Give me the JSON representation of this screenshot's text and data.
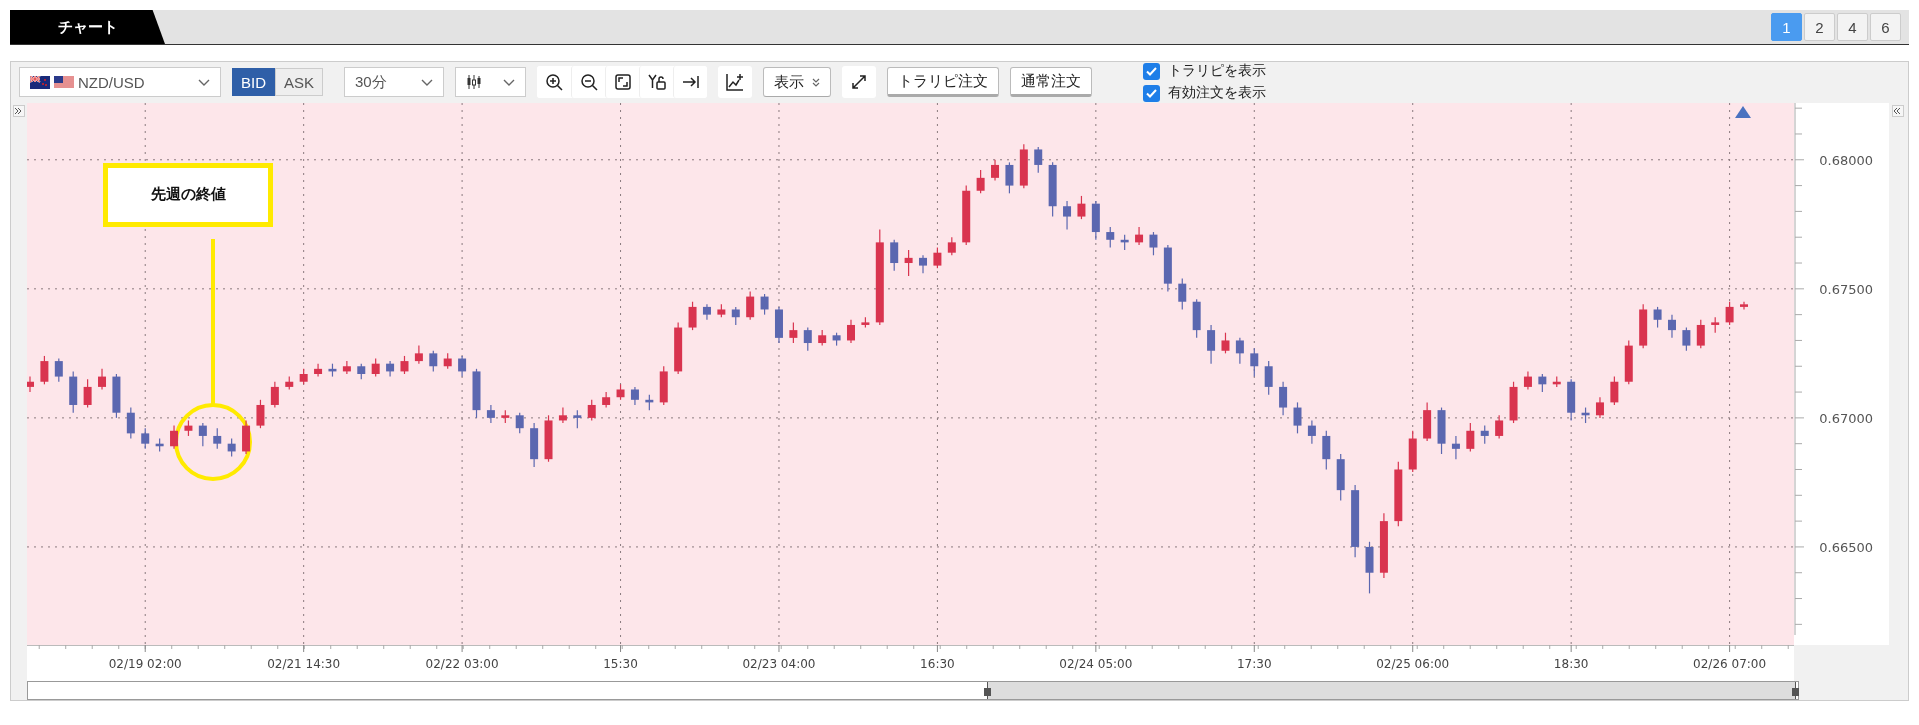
{
  "header": {
    "tab": {
      "label": "チャート",
      "selected": true
    },
    "layouts": [
      {
        "label": "1",
        "selected": true
      },
      {
        "label": "2",
        "selected": false
      },
      {
        "label": "4",
        "selected": false
      },
      {
        "label": "6",
        "selected": false
      }
    ]
  },
  "toolbar": {
    "symbol": "NZD/USD",
    "price_sides": [
      {
        "label": "BID",
        "selected": true
      },
      {
        "label": "ASK",
        "selected": false
      }
    ],
    "timeframe": "30分",
    "display_button": "表示",
    "order_buttons": [
      "トラリピ注文",
      "通常注文"
    ],
    "options": [
      {
        "label": "トラリピを表示",
        "checked": true
      },
      {
        "label": "有効注文を表示",
        "checked": true
      }
    ]
  },
  "chart": {
    "annotation": "先週の終値",
    "chart_data": {
      "type": "candlestick",
      "ylim": [
        0.6612,
        0.6822
      ],
      "grid": true,
      "yticks": [
        {
          "value": 0.68,
          "label": "0.68000"
        },
        {
          "value": 0.675,
          "label": "0.67500"
        },
        {
          "value": 0.67,
          "label": "0.67000"
        },
        {
          "value": 0.665,
          "label": "0.66500"
        }
      ],
      "categories": [
        null,
        null,
        null,
        null,
        null,
        null,
        null,
        null,
        "02/19 02:00",
        null,
        null,
        null,
        null,
        null,
        null,
        null,
        null,
        null,
        null,
        "02/21 14:30",
        null,
        null,
        null,
        null,
        null,
        null,
        null,
        null,
        null,
        null,
        "02/22 03:00",
        null,
        null,
        null,
        null,
        null,
        null,
        null,
        null,
        null,
        null,
        "15:30",
        null,
        null,
        null,
        null,
        null,
        null,
        null,
        null,
        null,
        null,
        "02/23 04:00",
        null,
        null,
        null,
        null,
        null,
        null,
        null,
        null,
        null,
        null,
        "16:30",
        null,
        null,
        null,
        null,
        null,
        null,
        null,
        null,
        null,
        null,
        "02/24 05:00",
        null,
        null,
        null,
        null,
        null,
        null,
        null,
        null,
        null,
        null,
        "17:30",
        null,
        null,
        null,
        null,
        null,
        null,
        null,
        null,
        null,
        null,
        "02/25 06:00",
        null,
        null,
        null,
        null,
        null,
        null,
        null,
        null,
        null,
        null,
        "18:30",
        null,
        null,
        null,
        null,
        null,
        null,
        null,
        null,
        null,
        null,
        "02/26 07:00",
        null
      ],
      "ohlc": [
        [
          0.6712,
          0.6716,
          0.671,
          0.6714
        ],
        [
          0.6714,
          0.6724,
          0.6713,
          0.6722
        ],
        [
          0.6722,
          0.6723,
          0.6714,
          0.6716
        ],
        [
          0.6716,
          0.6718,
          0.6702,
          0.6705
        ],
        [
          0.6705,
          0.6715,
          0.6704,
          0.6712
        ],
        [
          0.6712,
          0.6719,
          0.6711,
          0.6716
        ],
        [
          0.6716,
          0.6717,
          0.67,
          0.6702
        ],
        [
          0.6702,
          0.6704,
          0.6692,
          0.6694
        ],
        [
          0.6694,
          0.6696,
          0.6688,
          0.669
        ],
        [
          0.669,
          0.6692,
          0.6687,
          0.6689
        ],
        [
          0.6689,
          0.6697,
          0.6688,
          0.6695
        ],
        [
          0.6695,
          0.6699,
          0.6693,
          0.6697
        ],
        [
          0.6697,
          0.6698,
          0.6689,
          0.6693
        ],
        [
          0.6693,
          0.6696,
          0.6688,
          0.669
        ],
        [
          0.669,
          0.6692,
          0.6685,
          0.6687
        ],
        [
          0.6687,
          0.6699,
          0.6686,
          0.6697
        ],
        [
          0.6697,
          0.6707,
          0.6696,
          0.6705
        ],
        [
          0.6705,
          0.6714,
          0.6704,
          0.6712
        ],
        [
          0.6712,
          0.6716,
          0.6711,
          0.6714
        ],
        [
          0.6714,
          0.6719,
          0.6713,
          0.6717
        ],
        [
          0.6717,
          0.6721,
          0.6716,
          0.6719
        ],
        [
          0.6719,
          0.6721,
          0.6716,
          0.6718
        ],
        [
          0.6718,
          0.6722,
          0.6717,
          0.672
        ],
        [
          0.672,
          0.6721,
          0.6715,
          0.6717
        ],
        [
          0.6717,
          0.6723,
          0.6716,
          0.6721
        ],
        [
          0.6721,
          0.6722,
          0.6716,
          0.6718
        ],
        [
          0.6718,
          0.6724,
          0.6717,
          0.6722
        ],
        [
          0.6722,
          0.6728,
          0.6721,
          0.6725
        ],
        [
          0.6725,
          0.6726,
          0.6718,
          0.672
        ],
        [
          0.672,
          0.6725,
          0.6719,
          0.6723
        ],
        [
          0.6723,
          0.6724,
          0.6716,
          0.6718
        ],
        [
          0.6718,
          0.6719,
          0.67,
          0.6703
        ],
        [
          0.6703,
          0.6705,
          0.6698,
          0.67
        ],
        [
          0.67,
          0.6703,
          0.6698,
          0.6701
        ],
        [
          0.6701,
          0.6702,
          0.6694,
          0.6696
        ],
        [
          0.6696,
          0.6698,
          0.6681,
          0.6684
        ],
        [
          0.6684,
          0.6701,
          0.6683,
          0.6699
        ],
        [
          0.6699,
          0.6704,
          0.6698,
          0.6701
        ],
        [
          0.6701,
          0.6703,
          0.6696,
          0.67
        ],
        [
          0.67,
          0.6707,
          0.6699,
          0.6705
        ],
        [
          0.6705,
          0.671,
          0.6704,
          0.6708
        ],
        [
          0.6708,
          0.6713,
          0.6707,
          0.6711
        ],
        [
          0.6711,
          0.6712,
          0.6705,
          0.6707
        ],
        [
          0.6707,
          0.6709,
          0.6703,
          0.6706
        ],
        [
          0.6706,
          0.672,
          0.6705,
          0.6718
        ],
        [
          0.6718,
          0.6737,
          0.6717,
          0.6735
        ],
        [
          0.6735,
          0.6745,
          0.6734,
          0.6743
        ],
        [
          0.6743,
          0.6744,
          0.6738,
          0.674
        ],
        [
          0.674,
          0.6744,
          0.6739,
          0.6742
        ],
        [
          0.6742,
          0.6743,
          0.6736,
          0.6739
        ],
        [
          0.6739,
          0.6749,
          0.6738,
          0.6747
        ],
        [
          0.6747,
          0.6748,
          0.674,
          0.6742
        ],
        [
          0.6742,
          0.6743,
          0.6729,
          0.6731
        ],
        [
          0.6731,
          0.6737,
          0.6729,
          0.6734
        ],
        [
          0.6734,
          0.6735,
          0.6726,
          0.6729
        ],
        [
          0.6729,
          0.6734,
          0.6728,
          0.6732
        ],
        [
          0.6732,
          0.6733,
          0.6728,
          0.673
        ],
        [
          0.673,
          0.6738,
          0.6729,
          0.6736
        ],
        [
          0.6736,
          0.6739,
          0.6735,
          0.6737
        ],
        [
          0.6737,
          0.6773,
          0.6736,
          0.6768
        ],
        [
          0.6768,
          0.6769,
          0.6757,
          0.676
        ],
        [
          0.676,
          0.6765,
          0.6755,
          0.6762
        ],
        [
          0.6762,
          0.6763,
          0.6756,
          0.6759
        ],
        [
          0.6759,
          0.6766,
          0.6758,
          0.6764
        ],
        [
          0.6764,
          0.677,
          0.6763,
          0.6768
        ],
        [
          0.6768,
          0.679,
          0.6767,
          0.6788
        ],
        [
          0.6788,
          0.6796,
          0.6787,
          0.6793
        ],
        [
          0.6793,
          0.68,
          0.6792,
          0.6798
        ],
        [
          0.6798,
          0.6799,
          0.6787,
          0.679
        ],
        [
          0.679,
          0.6806,
          0.6789,
          0.6804
        ],
        [
          0.6804,
          0.6805,
          0.6795,
          0.6798
        ],
        [
          0.6798,
          0.6799,
          0.6778,
          0.6782
        ],
        [
          0.6782,
          0.6784,
          0.6773,
          0.6778
        ],
        [
          0.6778,
          0.6786,
          0.6777,
          0.6783
        ],
        [
          0.6783,
          0.6784,
          0.6769,
          0.6772
        ],
        [
          0.6772,
          0.6774,
          0.6766,
          0.6769
        ],
        [
          0.6769,
          0.6771,
          0.6765,
          0.6768
        ],
        [
          0.6768,
          0.6774,
          0.6767,
          0.6771
        ],
        [
          0.6771,
          0.6772,
          0.6763,
          0.6766
        ],
        [
          0.6766,
          0.6767,
          0.6749,
          0.6752
        ],
        [
          0.6752,
          0.6754,
          0.6742,
          0.6745
        ],
        [
          0.6745,
          0.6746,
          0.6731,
          0.6734
        ],
        [
          0.6734,
          0.6736,
          0.6721,
          0.6726
        ],
        [
          0.6726,
          0.6733,
          0.6725,
          0.673
        ],
        [
          0.673,
          0.6731,
          0.6721,
          0.6725
        ],
        [
          0.6725,
          0.6727,
          0.6716,
          0.672
        ],
        [
          0.672,
          0.6722,
          0.6709,
          0.6712
        ],
        [
          0.6712,
          0.6714,
          0.6701,
          0.6704
        ],
        [
          0.6704,
          0.6706,
          0.6694,
          0.6697
        ],
        [
          0.6697,
          0.6699,
          0.669,
          0.6693
        ],
        [
          0.6693,
          0.6695,
          0.668,
          0.6684
        ],
        [
          0.6684,
          0.6686,
          0.6668,
          0.6672
        ],
        [
          0.6672,
          0.6674,
          0.6646,
          0.665
        ],
        [
          0.665,
          0.6652,
          0.6632,
          0.664
        ],
        [
          0.664,
          0.6663,
          0.6638,
          0.666
        ],
        [
          0.666,
          0.6683,
          0.6658,
          0.668
        ],
        [
          0.668,
          0.6695,
          0.6679,
          0.6692
        ],
        [
          0.6692,
          0.6706,
          0.6691,
          0.6703
        ],
        [
          0.6703,
          0.6704,
          0.6686,
          0.669
        ],
        [
          0.669,
          0.6693,
          0.6684,
          0.6688
        ],
        [
          0.6688,
          0.6698,
          0.6687,
          0.6695
        ],
        [
          0.6695,
          0.6697,
          0.669,
          0.6693
        ],
        [
          0.6693,
          0.6701,
          0.6692,
          0.6699
        ],
        [
          0.6699,
          0.6714,
          0.6698,
          0.6712
        ],
        [
          0.6712,
          0.6718,
          0.6711,
          0.6716
        ],
        [
          0.6716,
          0.6717,
          0.671,
          0.6713
        ],
        [
          0.6713,
          0.6716,
          0.6712,
          0.6714
        ],
        [
          0.6714,
          0.6715,
          0.6699,
          0.6702
        ],
        [
          0.6702,
          0.6704,
          0.6698,
          0.6701
        ],
        [
          0.6701,
          0.6708,
          0.67,
          0.6706
        ],
        [
          0.6706,
          0.6716,
          0.6705,
          0.6714
        ],
        [
          0.6714,
          0.673,
          0.6713,
          0.6728
        ],
        [
          0.6728,
          0.6744,
          0.6727,
          0.6742
        ],
        [
          0.6742,
          0.6743,
          0.6735,
          0.6738
        ],
        [
          0.6738,
          0.674,
          0.6731,
          0.6734
        ],
        [
          0.6734,
          0.6735,
          0.6726,
          0.6728
        ],
        [
          0.6728,
          0.6738,
          0.6727,
          0.6736
        ],
        [
          0.6736,
          0.6739,
          0.6733,
          0.6737
        ],
        [
          0.6737,
          0.6745,
          0.6736,
          0.6743
        ],
        [
          0.6743,
          0.6745,
          0.6742,
          0.6744
        ]
      ]
    }
  }
}
